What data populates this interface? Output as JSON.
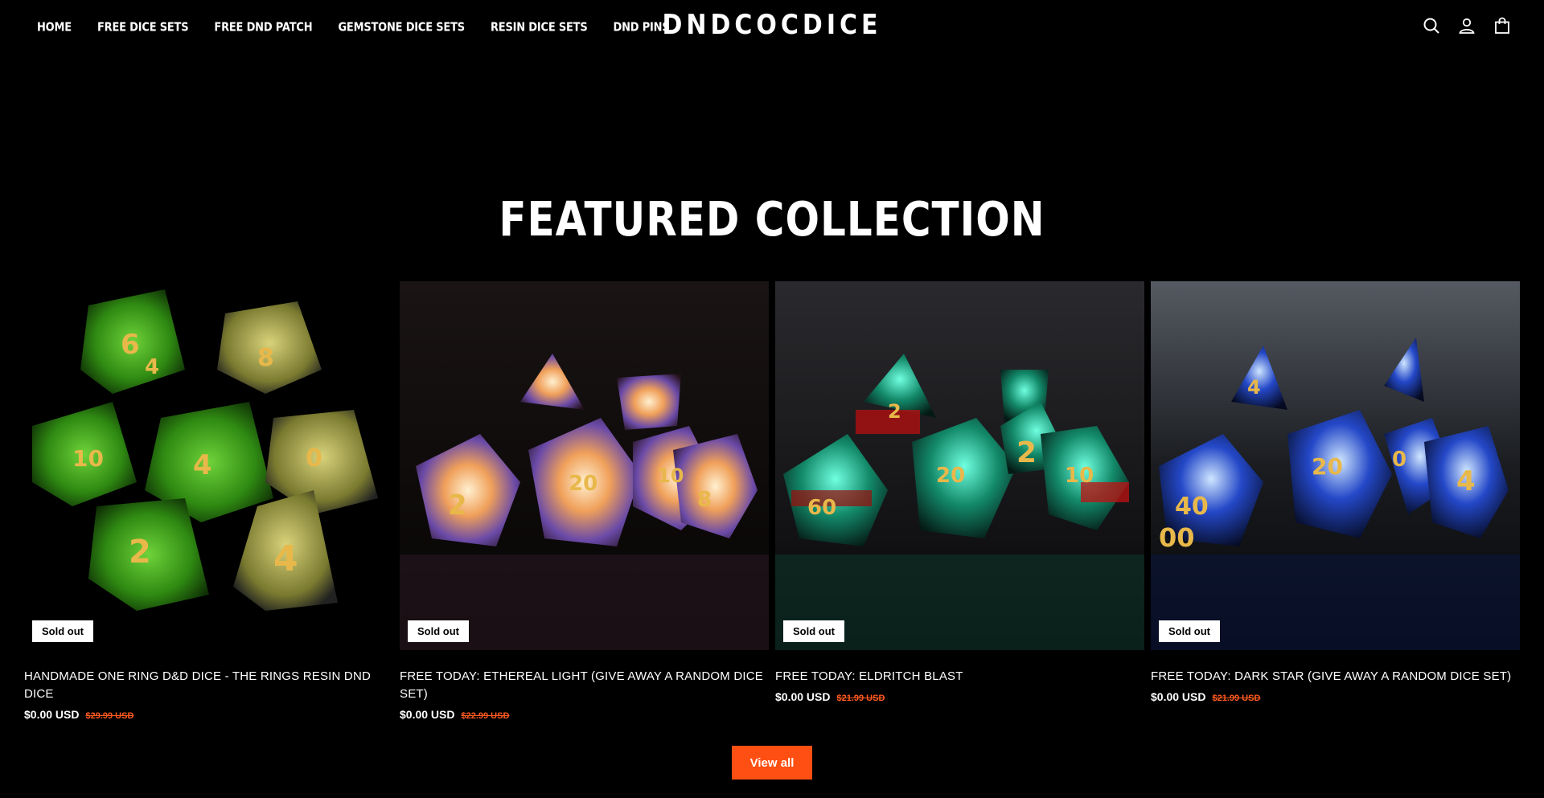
{
  "header": {
    "nav": [
      {
        "label": "HOME"
      },
      {
        "label": "FREE DICE SETS"
      },
      {
        "label": "FREE DND PATCH"
      },
      {
        "label": "GEMSTONE DICE SETS"
      },
      {
        "label": "RESIN DICE SETS"
      },
      {
        "label": "DND PINS"
      }
    ],
    "logo": "DNDCOCDICE",
    "icons": [
      "search-icon",
      "account-icon",
      "cart-icon"
    ]
  },
  "section": {
    "title": "FEATURED COLLECTION",
    "view_all_label": "View all"
  },
  "products": [
    {
      "title": "HANDMADE ONE RING D&D DICE - THE RINGS RESIN DND DICE",
      "price": "$0.00 USD",
      "compare_price": "$29.99 USD",
      "badge": "Sold out",
      "image_icon": "green-gold-dice-image",
      "theme": "green"
    },
    {
      "title": "FREE TODAY: ETHEREAL LIGHT (GIVE AWAY A RANDOM DICE SET)",
      "price": "$0.00 USD",
      "compare_price": "$22.99 USD",
      "badge": "Sold out",
      "image_icon": "opal-dice-image",
      "theme": "opal"
    },
    {
      "title": "FREE TODAY: ELDRITCH BLAST",
      "price": "$0.00 USD",
      "compare_price": "$21.99 USD",
      "badge": "Sold out",
      "image_icon": "teal-red-dice-image",
      "theme": "teal"
    },
    {
      "title": "FREE TODAY: DARK STAR (GIVE AWAY A RANDOM DICE SET)",
      "price": "$0.00 USD",
      "compare_price": "$21.99 USD",
      "badge": "Sold out",
      "image_icon": "dark-blue-dice-image",
      "theme": "blue"
    }
  ],
  "colors": {
    "background": "#000000",
    "accent": "#ff4f12",
    "compare_price": "#ff5a1f"
  }
}
